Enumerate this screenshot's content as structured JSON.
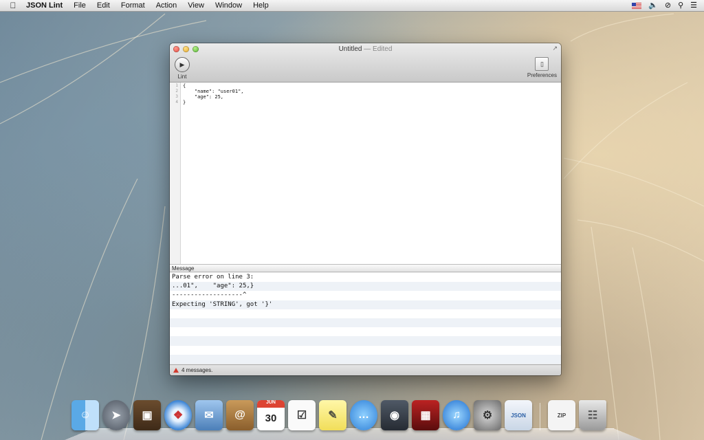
{
  "menubar": {
    "app_name": "JSON Lint",
    "items": [
      "File",
      "Edit",
      "Format",
      "Action",
      "View",
      "Window",
      "Help"
    ]
  },
  "window": {
    "title": "Untitled",
    "title_separator": " — ",
    "title_state": "Edited",
    "toolbar": {
      "lint_label": "Lint",
      "preferences_label": "Preferences"
    }
  },
  "editor": {
    "line_numbers": [
      "1",
      "2",
      "3",
      "4"
    ],
    "lines": [
      "{",
      "    \"name\": \"user01\",",
      "    \"age\": 25,",
      "}"
    ]
  },
  "messages": {
    "header": "Message",
    "rows": [
      "Parse error on line 3:",
      "...01\",    \"age\": 25,}",
      "-------------------^",
      "Expecting 'STRING', got '}'",
      "",
      "",
      "",
      "",
      "",
      ""
    ],
    "status": "4 messages."
  },
  "dock": {
    "calendar_day": "30",
    "json_label": "JSON",
    "zip_label": "ZIP"
  }
}
